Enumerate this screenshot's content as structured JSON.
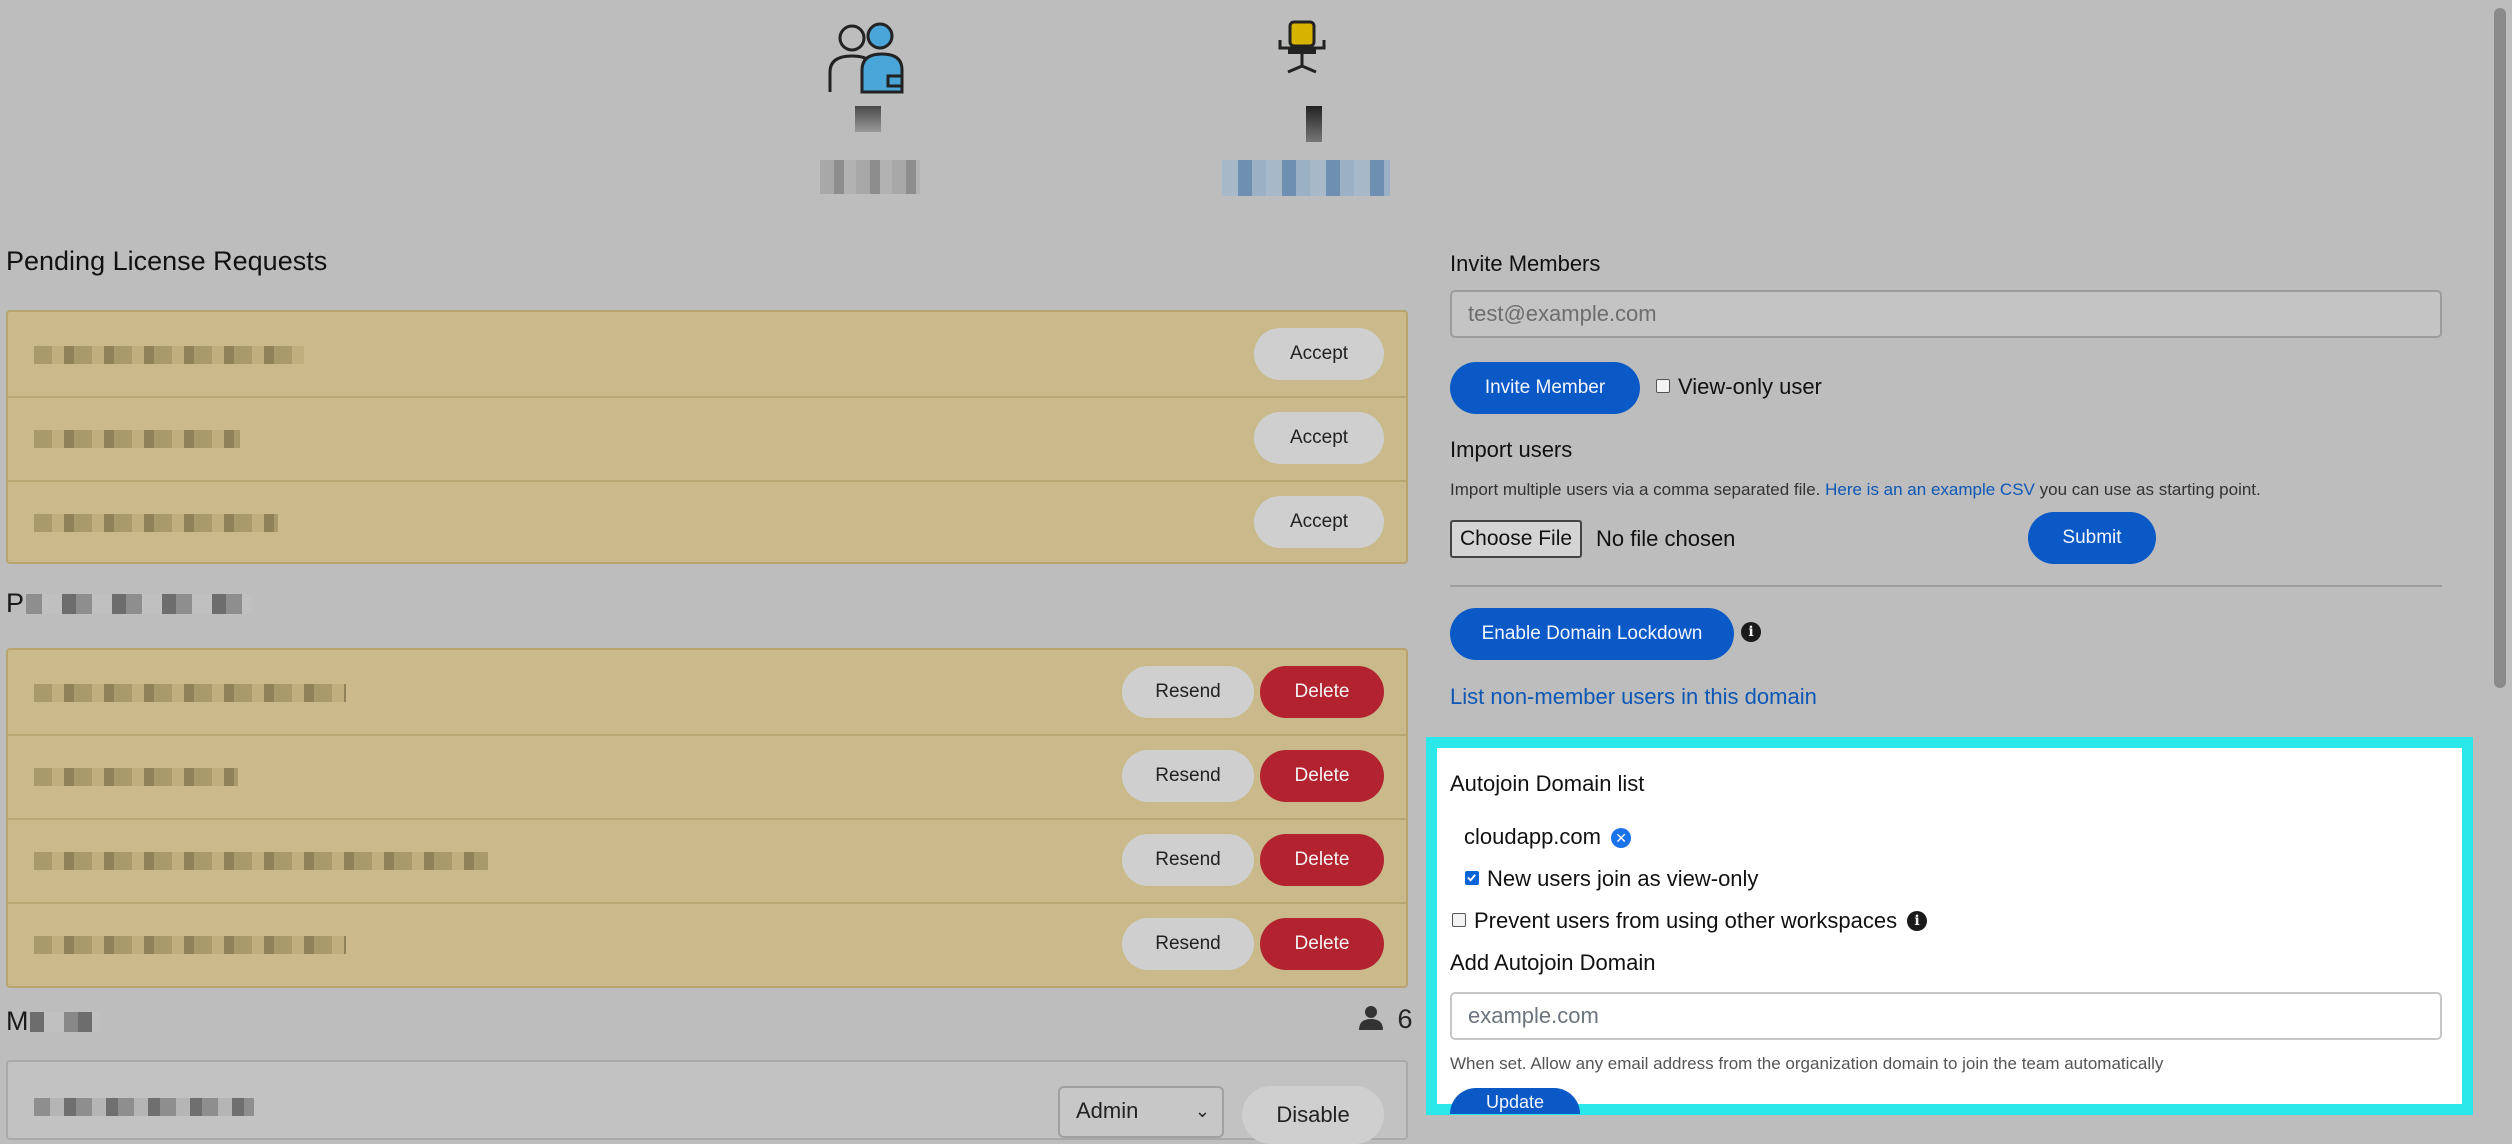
{
  "pending_requests": {
    "title": "Pending License Requests",
    "accept_label": "Accept",
    "rows": [
      {
        "name": ""
      },
      {
        "name": ""
      },
      {
        "name": ""
      }
    ]
  },
  "pending_invites": {
    "title_partial": "P",
    "resend_label": "Resend",
    "delete_label": "Delete"
  },
  "members": {
    "title_partial": "M",
    "count": "6",
    "role_value": "Admin",
    "disable_label": "Disable"
  },
  "invite": {
    "title": "Invite Members",
    "email_placeholder": "test@example.com",
    "invite_button": "Invite Member",
    "view_only_label": "View-only user"
  },
  "import": {
    "title": "Import users",
    "desc_before": "Import multiple users via a comma separated file. ",
    "desc_link": "Here is an an example CSV",
    "desc_after": " you can use as starting point.",
    "choose_file": "Choose File",
    "no_file": "No file chosen",
    "submit": "Submit"
  },
  "lockdown": {
    "button": "Enable Domain Lockdown",
    "list_link": "List non-member users in this domain"
  },
  "autojoin": {
    "title": "Autojoin Domain list",
    "domain": "cloudapp.com",
    "view_only_label": "New users join as view-only",
    "view_only_checked": true,
    "prevent_label": "Prevent users from using other workspaces",
    "prevent_checked": false,
    "add_title": "Add Autojoin Domain",
    "domain_placeholder": "example.com",
    "help": "When set. Allow any email address from the organization domain to join the team automatically",
    "update": "Update"
  },
  "colors": {
    "accent_blue": "#0b59c7",
    "danger_red": "#b3232f",
    "highlight_cyan": "#2ae8ea",
    "request_panel": "#c9b98b"
  }
}
